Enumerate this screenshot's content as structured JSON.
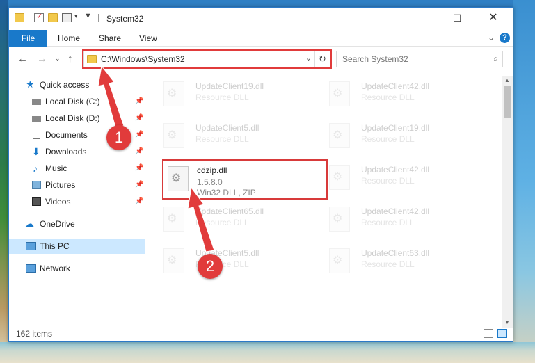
{
  "window": {
    "title": "System32"
  },
  "ribbon": {
    "file": "File",
    "tabs": [
      "Home",
      "Share",
      "View"
    ],
    "help": "?"
  },
  "address": {
    "path": "C:\\Windows\\System32"
  },
  "search": {
    "placeholder": "Search System32"
  },
  "nav": {
    "quick_access": "Quick access",
    "items": [
      {
        "label": "Local Disk (C:)",
        "icon": "drive-icon"
      },
      {
        "label": "Local Disk (D:)",
        "icon": "drive-icon"
      },
      {
        "label": "Documents",
        "icon": "documents-icon"
      },
      {
        "label": "Downloads",
        "icon": "downloads-icon"
      },
      {
        "label": "Music",
        "icon": "music-icon"
      },
      {
        "label": "Pictures",
        "icon": "pictures-icon"
      },
      {
        "label": "Videos",
        "icon": "videos-icon"
      }
    ],
    "onedrive": "OneDrive",
    "this_pc": "This PC",
    "network": "Network"
  },
  "files": {
    "highlighted": {
      "name": "cdzip.dll",
      "version": "1.5.8.0",
      "type": "Win32 DLL, ZIP"
    },
    "faded": [
      {
        "name": "UpdateClient19.dll",
        "desc": "Resource DLL"
      },
      {
        "name": "UpdateClient42.dll",
        "desc": "Resource DLL"
      },
      {
        "name": "UpdateClient5.dll",
        "desc": "Resource DLL"
      },
      {
        "name": "UpdateClient19.dll",
        "desc": "Resource DLL"
      },
      {
        "name": "UpdateClient42.dll",
        "desc": "Resource DLL"
      },
      {
        "name": "UpdateClient65.dll",
        "desc": "Resource DLL"
      },
      {
        "name": "UpdateClient42.dll",
        "desc": "Resource DLL"
      },
      {
        "name": "UpdateClient5.dll",
        "desc": "Resource DLL"
      },
      {
        "name": "UpdateClient63.dll",
        "desc": "Resource DLL"
      }
    ]
  },
  "status": {
    "count": "162 items"
  },
  "annotations": {
    "step1": "1",
    "step2": "2"
  },
  "colors": {
    "accent": "#1979ca",
    "annotation": "#e13b3b",
    "selected": "#cce8ff"
  }
}
